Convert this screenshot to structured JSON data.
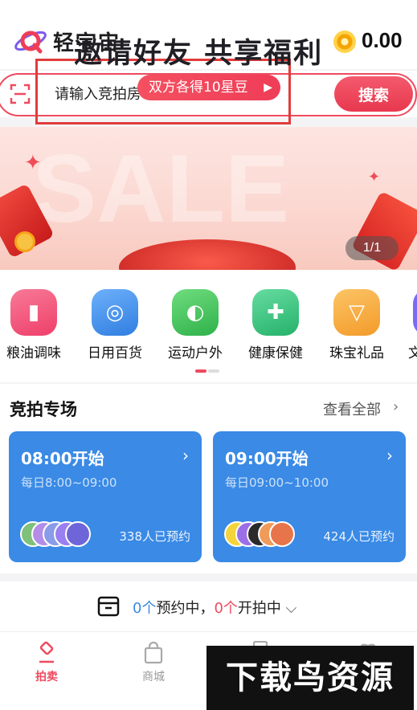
{
  "app": {
    "title": "轻宇宙",
    "balance": "0.00"
  },
  "search": {
    "placeholder": "请输入竞拍房号或商品名称...",
    "button_label": "搜索"
  },
  "banner": {
    "watermark": "SALE",
    "title": "邀请好友 共享福利",
    "pill": "双方各得10星豆",
    "pager": "1/1"
  },
  "categories": [
    {
      "label": "粮油调味",
      "color": "#f25a7c",
      "icon": "oil-bottle-icon"
    },
    {
      "label": "日用百货",
      "color": "#3d8de8",
      "icon": "tissue-roll-icon"
    },
    {
      "label": "运动户外",
      "color": "#3ec35a",
      "icon": "ball-icon"
    },
    {
      "label": "健康保健",
      "color": "#34c27a",
      "icon": "medicine-icon"
    },
    {
      "label": "珠宝礼品",
      "color": "#f7a435",
      "icon": "necklace-icon"
    },
    {
      "label": "文",
      "color": "#7a6cf0",
      "icon": "book-icon"
    }
  ],
  "auction": {
    "title": "竞拍专场",
    "see_all": "查看全部",
    "sessions": [
      {
        "time": "08:00开始",
        "range": "每日8:00~09:00",
        "count": "338人已预约"
      },
      {
        "time": "09:00开始",
        "range": "每日09:00~10:00",
        "count": "424人已预约"
      }
    ]
  },
  "reservation": {
    "reserved_count": "0个",
    "reserved_label": "预约中，",
    "bidding_count": "0个",
    "bidding_label": "开拍中"
  },
  "tabs": [
    {
      "label": "拍卖",
      "active": true
    },
    {
      "label": "商城",
      "active": false
    }
  ],
  "watermark": "下载鸟资源",
  "colors": {
    "accent": "#ef4a5f",
    "card_blue": "#3a8ae6"
  }
}
